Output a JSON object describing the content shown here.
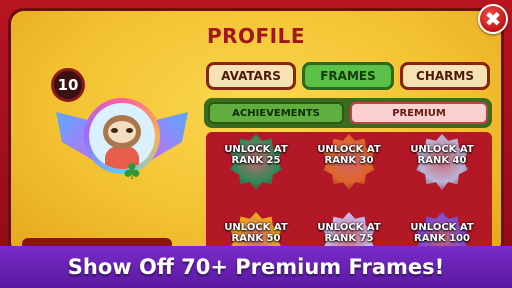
{
  "screen": {
    "title": "PROFILE",
    "close_label": "✖"
  },
  "player": {
    "rank": "10",
    "avatar_icon": "sloth-avatar",
    "badge_icon": "clover-icon"
  },
  "tabs": [
    {
      "label": "AVATARS",
      "selected": false
    },
    {
      "label": "FRAMES",
      "selected": true
    },
    {
      "label": "CHARMS",
      "selected": false
    }
  ],
  "subtabs": [
    {
      "label": "ACHIEVEMENTS",
      "selected": true
    },
    {
      "label": "PREMIUM",
      "selected": false
    }
  ],
  "frames": [
    {
      "line1": "UNLOCK AT",
      "line2": "RANK 25",
      "color": "#2f8a5a"
    },
    {
      "line1": "UNLOCK AT",
      "line2": "RANK 30",
      "color": "#e0652a"
    },
    {
      "line1": "UNLOCK AT",
      "line2": "RANK 40",
      "color": "#b9b4d8"
    },
    {
      "line1": "UNLOCK AT",
      "line2": "RANK 50",
      "color": "#f0a81c"
    },
    {
      "line1": "UNLOCK AT",
      "line2": "RANK 75",
      "color": "#c9b8f0"
    },
    {
      "line1": "UNLOCK AT",
      "line2": "RANK 100",
      "color": "#7a4ad8"
    }
  ],
  "banner": {
    "text": "Show Off 70+ Premium Frames!"
  },
  "colors": {
    "frame_red": "#b8141f",
    "panel_yellow": "#f2c23a",
    "selected_green": "#5cc148",
    "banner_purple": "#7a2bc9"
  }
}
